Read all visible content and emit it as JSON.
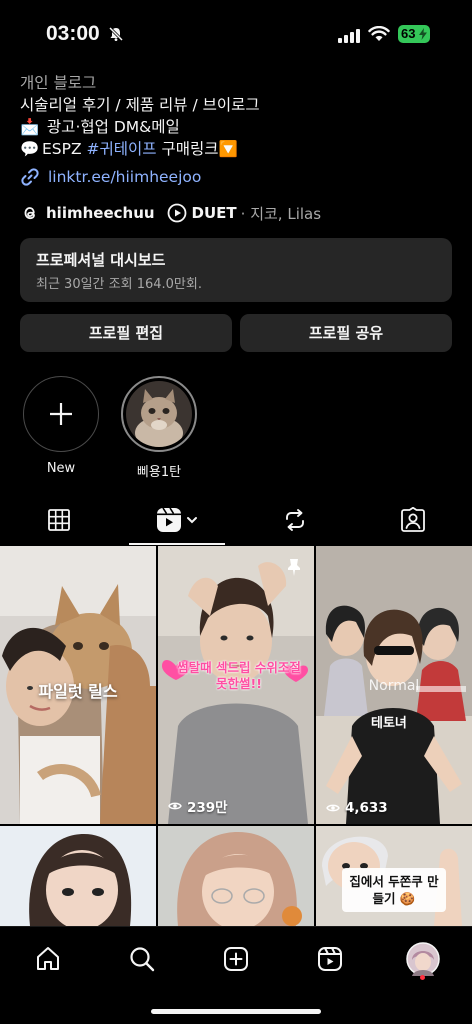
{
  "status": {
    "time": "03:00",
    "battery": "63"
  },
  "bio": {
    "category": "개인 블로그",
    "line1": "시술리얼 후기 / 제품 리뷰 / 브이로그",
    "line2_emoji": "📩",
    "line2": " 광고·협업 DM&메일",
    "line3_emoji": "💬",
    "line3_prefix": "ESPZ ",
    "line3_tag": "#귀테이프",
    "line3_suffix": " 구매링크🔽",
    "link": "linktr.ee/hiimheejoo"
  },
  "chips": {
    "threads_name": "hiimheechuu",
    "music_title": "DUET",
    "music_artist": "· 지코, Lilas"
  },
  "dashboard": {
    "title": "프로페셔널 대시보드",
    "subtitle": "최근 30일간 조회 164.0만회."
  },
  "buttons": {
    "edit": "프로필 편집",
    "share": "프로필 공유"
  },
  "highlights": [
    {
      "label": "New"
    },
    {
      "label": "삐용1탄"
    }
  ],
  "reels": [
    {
      "title": "파일럿 릴스",
      "views": ""
    },
    {
      "overlay": "썸탈때 섹드립 수위조절 못한썰!!",
      "views": "239만",
      "pinned": true
    },
    {
      "tag": "Normal",
      "shirt": "테토녀",
      "views": "4,633"
    },
    {
      "title": "",
      "views": ""
    },
    {
      "title": "",
      "views": ""
    },
    {
      "sticker": "집에서 두쫀쿠 만들기 🍪",
      "views": ""
    }
  ],
  "colors": {
    "background": "#000000",
    "card": "#262626",
    "link": "#8fb3ff",
    "battery": "#34c759",
    "notification": "#ff3040"
  },
  "nav_icons": [
    "home-icon",
    "search-icon",
    "create-icon",
    "reels-icon",
    "profile-avatar"
  ]
}
